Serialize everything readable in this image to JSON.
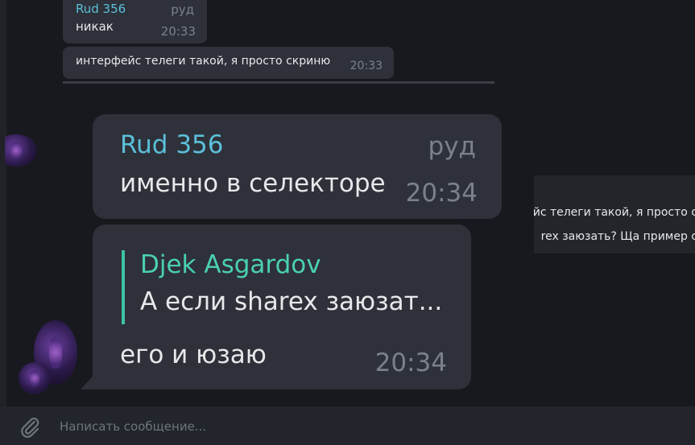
{
  "messages": [
    {
      "sender": "Rud 356",
      "alias": "руд",
      "text": "никак",
      "time": "20:33"
    },
    {
      "text": "интерфейс телеги такой, я просто скриню",
      "time": "20:33"
    }
  ],
  "preview": {
    "line1": "йс телеги такой, я просто с",
    "line2": "rex заюзать? Ща пример с"
  },
  "zoomed": {
    "msg1": {
      "sender": "Rud 356",
      "alias": "руд",
      "text": "именно в селекторе",
      "time": "20:34"
    },
    "msg2": {
      "reply_name": "Djek Asgardov",
      "reply_text": "А если sharex заюзат...",
      "text": "его и юзаю",
      "time": "20:34"
    }
  },
  "composer": {
    "placeholder": "Написать сообщение...",
    "icon": "paperclip-icon"
  },
  "colors": {
    "background": "#18191e",
    "bubble": "#2e3139",
    "sender": "#5bbfd9",
    "reply_accent": "#3fc3a6"
  }
}
